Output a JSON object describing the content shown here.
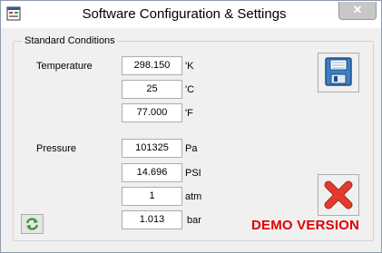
{
  "window": {
    "title": "Software Configuration & Settings"
  },
  "group": {
    "label": "Standard Conditions"
  },
  "temperature": {
    "label": "Temperature",
    "rows": [
      {
        "value": "298.150",
        "unit": "'K"
      },
      {
        "value": "25",
        "unit": "'C"
      },
      {
        "value": "77.000",
        "unit": "'F"
      }
    ]
  },
  "pressure": {
    "label": "Pressure",
    "rows": [
      {
        "value": "101325",
        "unit": "Pa"
      },
      {
        "value": "14.696",
        "unit": "PSI"
      },
      {
        "value": "1",
        "unit": "atm"
      },
      {
        "value": "1.013",
        "unit": "bar"
      }
    ]
  },
  "demo_label": "DEMO VERSION",
  "icons": {
    "app": "app-window-icon",
    "close": "close-x-icon",
    "save": "floppy-disk-icon",
    "cancel": "red-x-icon",
    "refresh": "green-refresh-icon"
  },
  "colors": {
    "demo": "#e00000",
    "save_blue": "#3b7fc4",
    "cancel_red": "#e23b2e"
  }
}
